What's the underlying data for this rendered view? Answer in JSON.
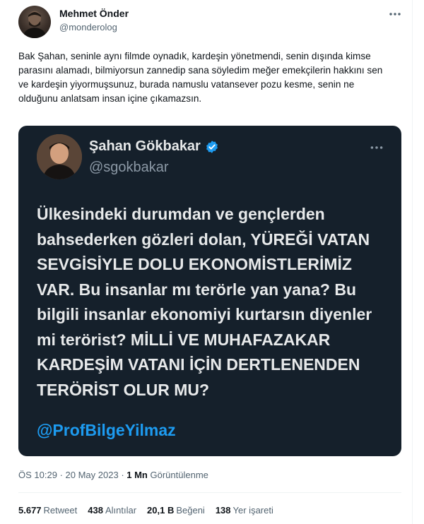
{
  "author": {
    "name": "Mehmet Önder",
    "handle": "@monderolog"
  },
  "tweet_text": "Bak Şahan, seninle aynı filmde oynadık, kardeşin yönetmendi, senin dışında kimse parasını alamadı, bilmiyorsun zannedip sana söyledim meğer emekçilerin hakkını sen ve kardeşin yiyormuşsunuz, burada namuslu vatansever pozu kesme, senin ne olduğunu anlatsam insan içine çıkamazsın.",
  "quoted": {
    "name": "Şahan Gökbakar",
    "handle": "@sgokbakar",
    "text": "Ülkesindeki durumdan ve gençlerden bahsederken gözleri dolan, YÜREĞİ VATAN SEVGİSİYLE DOLU EKONOMİSTLERİMİZ VAR. Bu insanlar mı terörle yan yana? Bu bilgili insanlar ekonomiyi kurtarsın diyenler mi terörist? MİLLİ VE MUHAFAZAKAR KARDEŞİM VATANI İÇİN DERTLENENDEN TERÖRİST OLUR MU?",
    "mention": "@ProfBilgeYilmaz"
  },
  "meta": {
    "time": "ÖS 10:29",
    "date": "20 May 2023",
    "views_count": "1 Mn",
    "views_label": "Görüntülenme"
  },
  "stats": {
    "retweets": {
      "count": "5.677",
      "label": "Retweet"
    },
    "quotes": {
      "count": "438",
      "label": "Alıntılar"
    },
    "likes": {
      "count": "20,1 B",
      "label": "Beğeni"
    },
    "bookmarks": {
      "count": "138",
      "label": "Yer işareti"
    }
  },
  "icons": {
    "more": "more-horizontal-icon",
    "verified": "verified-badge-icon"
  },
  "colors": {
    "accent": "#1d9bf0",
    "quote_bg": "#15202b",
    "text": "#0f1419",
    "secondary": "#536471"
  }
}
